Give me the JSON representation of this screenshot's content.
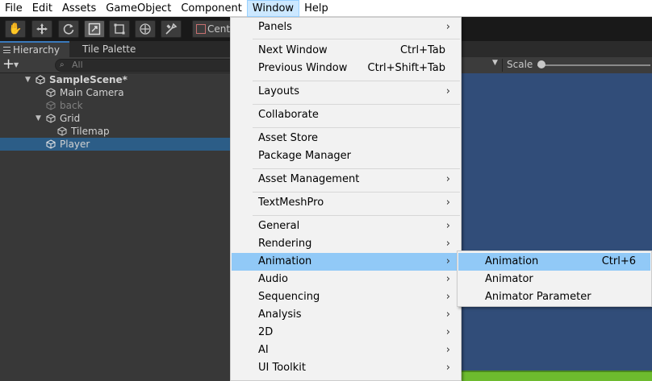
{
  "menubar": {
    "items": [
      "File",
      "Edit",
      "Assets",
      "GameObject",
      "Component",
      "Window",
      "Help"
    ],
    "active_index": 5
  },
  "toolbar": {
    "tools": [
      "hand-icon",
      "move-icon",
      "rotate-icon",
      "scale-icon",
      "rect-icon",
      "transform-icon",
      "custom-tool-icon"
    ],
    "selected_tool": "scale-icon",
    "pivot_label": "Cent"
  },
  "hierarchy": {
    "tabs": [
      "Hierarchy",
      "Tile Palette"
    ],
    "active_tab": "Hierarchy",
    "search_placeholder": "All",
    "rows": [
      {
        "label": "SampleScene*",
        "level": 0,
        "expanded": true,
        "scene": true
      },
      {
        "label": "Main Camera",
        "level": 1
      },
      {
        "label": "back",
        "level": 1,
        "disabled": true
      },
      {
        "label": "Grid",
        "level": 1,
        "expanded": true
      },
      {
        "label": "Tilemap",
        "level": 2
      },
      {
        "label": "Player",
        "level": 1,
        "selected": true
      }
    ]
  },
  "scene": {
    "scale_label": "Scale",
    "background_color": "#314d79"
  },
  "window_menu": {
    "items": [
      {
        "label": "Panels",
        "submenu": true
      },
      {
        "separator": true
      },
      {
        "label": "Next Window",
        "shortcut": "Ctrl+Tab"
      },
      {
        "label": "Previous Window",
        "shortcut": "Ctrl+Shift+Tab"
      },
      {
        "separator": true
      },
      {
        "label": "Layouts",
        "submenu": true
      },
      {
        "separator": true
      },
      {
        "label": "Collaborate"
      },
      {
        "separator": true
      },
      {
        "label": "Asset Store"
      },
      {
        "label": "Package Manager"
      },
      {
        "separator": true
      },
      {
        "label": "Asset Management",
        "submenu": true
      },
      {
        "separator": true
      },
      {
        "label": "TextMeshPro",
        "submenu": true
      },
      {
        "separator": true
      },
      {
        "label": "General",
        "submenu": true
      },
      {
        "label": "Rendering",
        "submenu": true
      },
      {
        "label": "Animation",
        "submenu": true,
        "highlighted": true
      },
      {
        "label": "Audio",
        "submenu": true
      },
      {
        "label": "Sequencing",
        "submenu": true
      },
      {
        "label": "Analysis",
        "submenu": true
      },
      {
        "label": "2D",
        "submenu": true
      },
      {
        "label": "AI",
        "submenu": true
      },
      {
        "label": "UI Toolkit",
        "submenu": true
      }
    ]
  },
  "animation_submenu": {
    "items": [
      {
        "label": "Animation",
        "shortcut": "Ctrl+6",
        "highlighted": true
      },
      {
        "label": "Animator"
      },
      {
        "label": "Animator Parameter"
      }
    ]
  },
  "colors": {
    "menu_highlight": "#91c9f7",
    "hierarchy_selection": "#2c5d87",
    "menu_background": "#f2f2f2"
  }
}
